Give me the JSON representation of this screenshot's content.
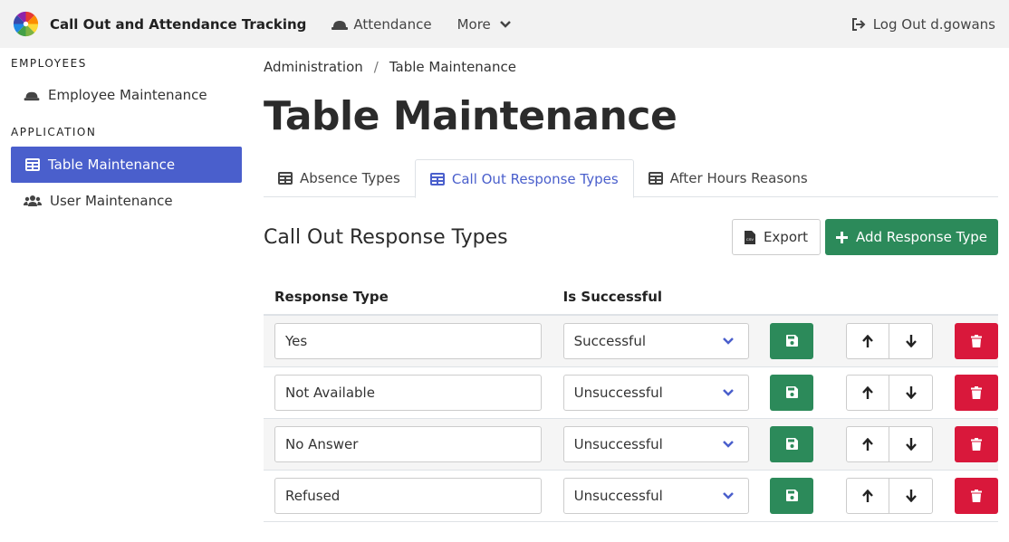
{
  "navbar": {
    "app_title": "Call Out and Attendance Tracking",
    "attendance_label": "Attendance",
    "more_label": "More",
    "logout_label": "Log Out d.gowans"
  },
  "sidebar": {
    "sections": [
      {
        "heading": "EMPLOYEES",
        "items": [
          {
            "label": "Employee Maintenance",
            "icon": "hard-hat-icon",
            "active": false
          }
        ]
      },
      {
        "heading": "APPLICATION",
        "items": [
          {
            "label": "Table Maintenance",
            "icon": "table-icon",
            "active": true
          },
          {
            "label": "User Maintenance",
            "icon": "users-icon",
            "active": false
          }
        ]
      }
    ]
  },
  "breadcrumb": {
    "items": [
      "Administration",
      "Table Maintenance"
    ],
    "separator": "/"
  },
  "page_title": "Table Maintenance",
  "tabs": [
    {
      "label": "Absence Types",
      "active": false
    },
    {
      "label": "Call Out Response Types",
      "active": true
    },
    {
      "label": "After Hours Reasons",
      "active": false
    }
  ],
  "section": {
    "title": "Call Out Response Types",
    "export_label": "Export",
    "add_label": "Add Response Type"
  },
  "table": {
    "columns": [
      "Response Type",
      "Is Successful"
    ],
    "rows": [
      {
        "response_type": "Yes",
        "is_successful": "Successful"
      },
      {
        "response_type": "Not Available",
        "is_successful": "Unsuccessful"
      },
      {
        "response_type": "No Answer",
        "is_successful": "Unsuccessful"
      },
      {
        "response_type": "Refused",
        "is_successful": "Unsuccessful"
      }
    ]
  },
  "colors": {
    "primary": "#4a5fcc",
    "success": "#2c8a5a",
    "danger": "#d9183b"
  }
}
